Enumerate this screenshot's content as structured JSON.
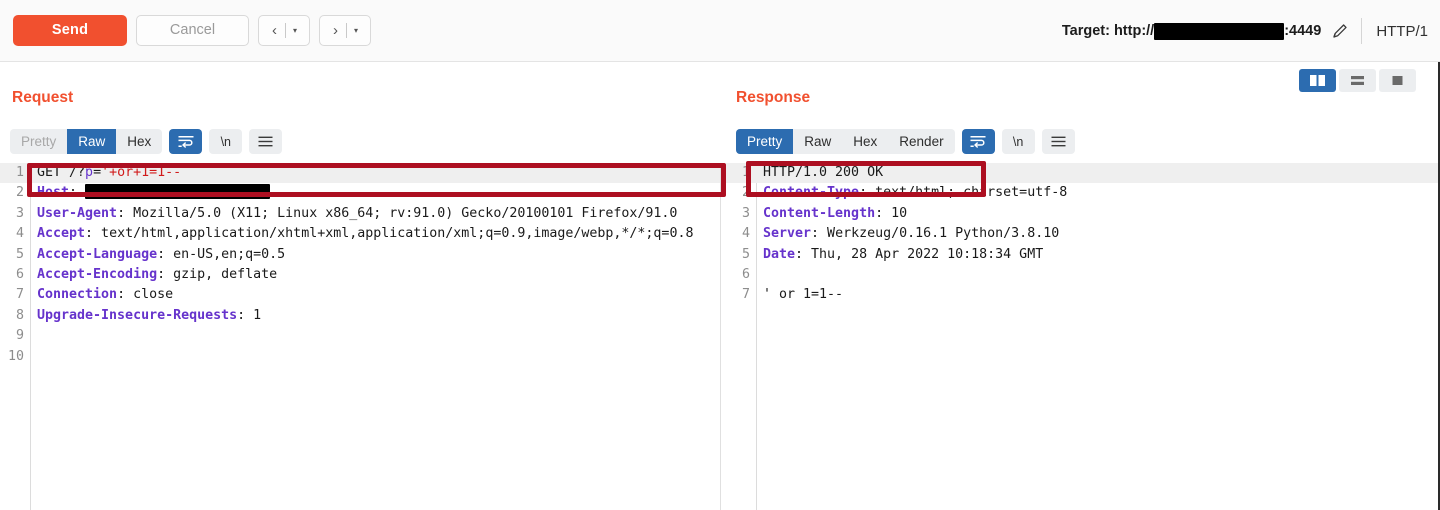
{
  "toolbar": {
    "send_label": "Send",
    "cancel_label": "Cancel",
    "prev_arrow": "‹",
    "next_arrow": "›",
    "caret": "▾",
    "target_prefix": "Target: http://",
    "target_host_redacted": true,
    "target_port": ":4449",
    "edit_icon": "pencil-icon",
    "http_version": "HTTP/1"
  },
  "view_modes": [
    {
      "name": "side-by-side",
      "icon": "split-vertical-icon",
      "active": true
    },
    {
      "name": "stacked",
      "icon": "split-horizontal-icon",
      "active": false
    },
    {
      "name": "single",
      "icon": "single-pane-icon",
      "active": false
    }
  ],
  "request": {
    "title": "Request",
    "tabs": [
      {
        "label": "Pretty",
        "active": false,
        "disabled": true
      },
      {
        "label": "Raw",
        "active": true,
        "disabled": false
      },
      {
        "label": "Hex",
        "active": false,
        "disabled": false
      }
    ],
    "buttons": [
      {
        "name": "word-wrap-button",
        "icon": "word-wrap-icon",
        "active": true
      },
      {
        "name": "show-newlines-button",
        "label": "\\n",
        "active": false
      },
      {
        "name": "menu-button",
        "icon": "hamburger-icon",
        "active": false
      }
    ],
    "lines": [
      {
        "num": "1",
        "highlighted": true,
        "parts": [
          {
            "t": "GET /?",
            "c": "blk"
          },
          {
            "t": "p",
            "c": "purp"
          },
          {
            "t": "=",
            "c": "blk"
          },
          {
            "t": "'+or+1=1--",
            "c": "red"
          }
        ]
      },
      {
        "num": "2",
        "highlighted": false,
        "parts": [
          {
            "t": "Host",
            "c": "hdr"
          },
          {
            "t": ": ",
            "c": "blk"
          },
          {
            "t": "",
            "c": "redact",
            "w": 185
          }
        ]
      },
      {
        "num": "3",
        "highlighted": false,
        "parts": [
          {
            "t": "User-Agent",
            "c": "hdr"
          },
          {
            "t": ": Mozilla/5.0 (X11; Linux x86_64; rv:91.0) Gecko/20100101 Firefox/91.0",
            "c": "blk"
          }
        ]
      },
      {
        "num": "4",
        "highlighted": false,
        "parts": [
          {
            "t": "Accept",
            "c": "hdr"
          },
          {
            "t": ": text/html,application/xhtml+xml,application/xml;q=0.9,image/webp,*/*;q=0.8",
            "c": "blk"
          }
        ]
      },
      {
        "num": "5",
        "highlighted": false,
        "parts": [
          {
            "t": "Accept-Language",
            "c": "hdr"
          },
          {
            "t": ": en-US,en;q=0.5",
            "c": "blk"
          }
        ]
      },
      {
        "num": "6",
        "highlighted": false,
        "parts": [
          {
            "t": "Accept-Encoding",
            "c": "hdr"
          },
          {
            "t": ": gzip, deflate",
            "c": "blk"
          }
        ]
      },
      {
        "num": "7",
        "highlighted": false,
        "parts": [
          {
            "t": "Connection",
            "c": "hdr"
          },
          {
            "t": ": close",
            "c": "blk"
          }
        ]
      },
      {
        "num": "8",
        "highlighted": false,
        "parts": [
          {
            "t": "Upgrade-Insecure-Requests",
            "c": "hdr"
          },
          {
            "t": ": 1",
            "c": "blk"
          }
        ]
      },
      {
        "num": "9",
        "highlighted": false,
        "parts": []
      },
      {
        "num": "10",
        "highlighted": false,
        "parts": []
      }
    ]
  },
  "response": {
    "title": "Response",
    "tabs": [
      {
        "label": "Pretty",
        "active": true,
        "disabled": false
      },
      {
        "label": "Raw",
        "active": false,
        "disabled": false
      },
      {
        "label": "Hex",
        "active": false,
        "disabled": false
      },
      {
        "label": "Render",
        "active": false,
        "disabled": false
      }
    ],
    "buttons": [
      {
        "name": "word-wrap-button",
        "icon": "word-wrap-icon",
        "active": true
      },
      {
        "name": "show-newlines-button",
        "label": "\\n",
        "active": false
      },
      {
        "name": "menu-button",
        "icon": "hamburger-icon",
        "active": false
      }
    ],
    "lines": [
      {
        "num": "1",
        "highlighted": true,
        "parts": [
          {
            "t": "HTTP/1.0 200 OK",
            "c": "blk"
          }
        ]
      },
      {
        "num": "2",
        "highlighted": false,
        "parts": [
          {
            "t": "Content-Type",
            "c": "hdr"
          },
          {
            "t": ": text/html; charset=utf-8",
            "c": "blk"
          }
        ]
      },
      {
        "num": "3",
        "highlighted": false,
        "parts": [
          {
            "t": "Content-Length",
            "c": "hdr"
          },
          {
            "t": ": 10",
            "c": "blk"
          }
        ]
      },
      {
        "num": "4",
        "highlighted": false,
        "parts": [
          {
            "t": "Server",
            "c": "hdr"
          },
          {
            "t": ": Werkzeug/0.16.1 Python/3.8.10",
            "c": "blk"
          }
        ]
      },
      {
        "num": "5",
        "highlighted": false,
        "parts": [
          {
            "t": "Date",
            "c": "hdr"
          },
          {
            "t": ": Thu, 28 Apr 2022 10:18:34 GMT",
            "c": "blk"
          }
        ]
      },
      {
        "num": "6",
        "highlighted": false,
        "parts": []
      },
      {
        "num": "7",
        "highlighted": false,
        "parts": [
          {
            "t": "' or 1=1--",
            "c": "blk"
          }
        ]
      }
    ]
  },
  "annotations": [
    {
      "name": "request-line-highlight-box",
      "color": "#ad0f21"
    },
    {
      "name": "response-status-highlight-box",
      "color": "#ad0f21"
    }
  ]
}
